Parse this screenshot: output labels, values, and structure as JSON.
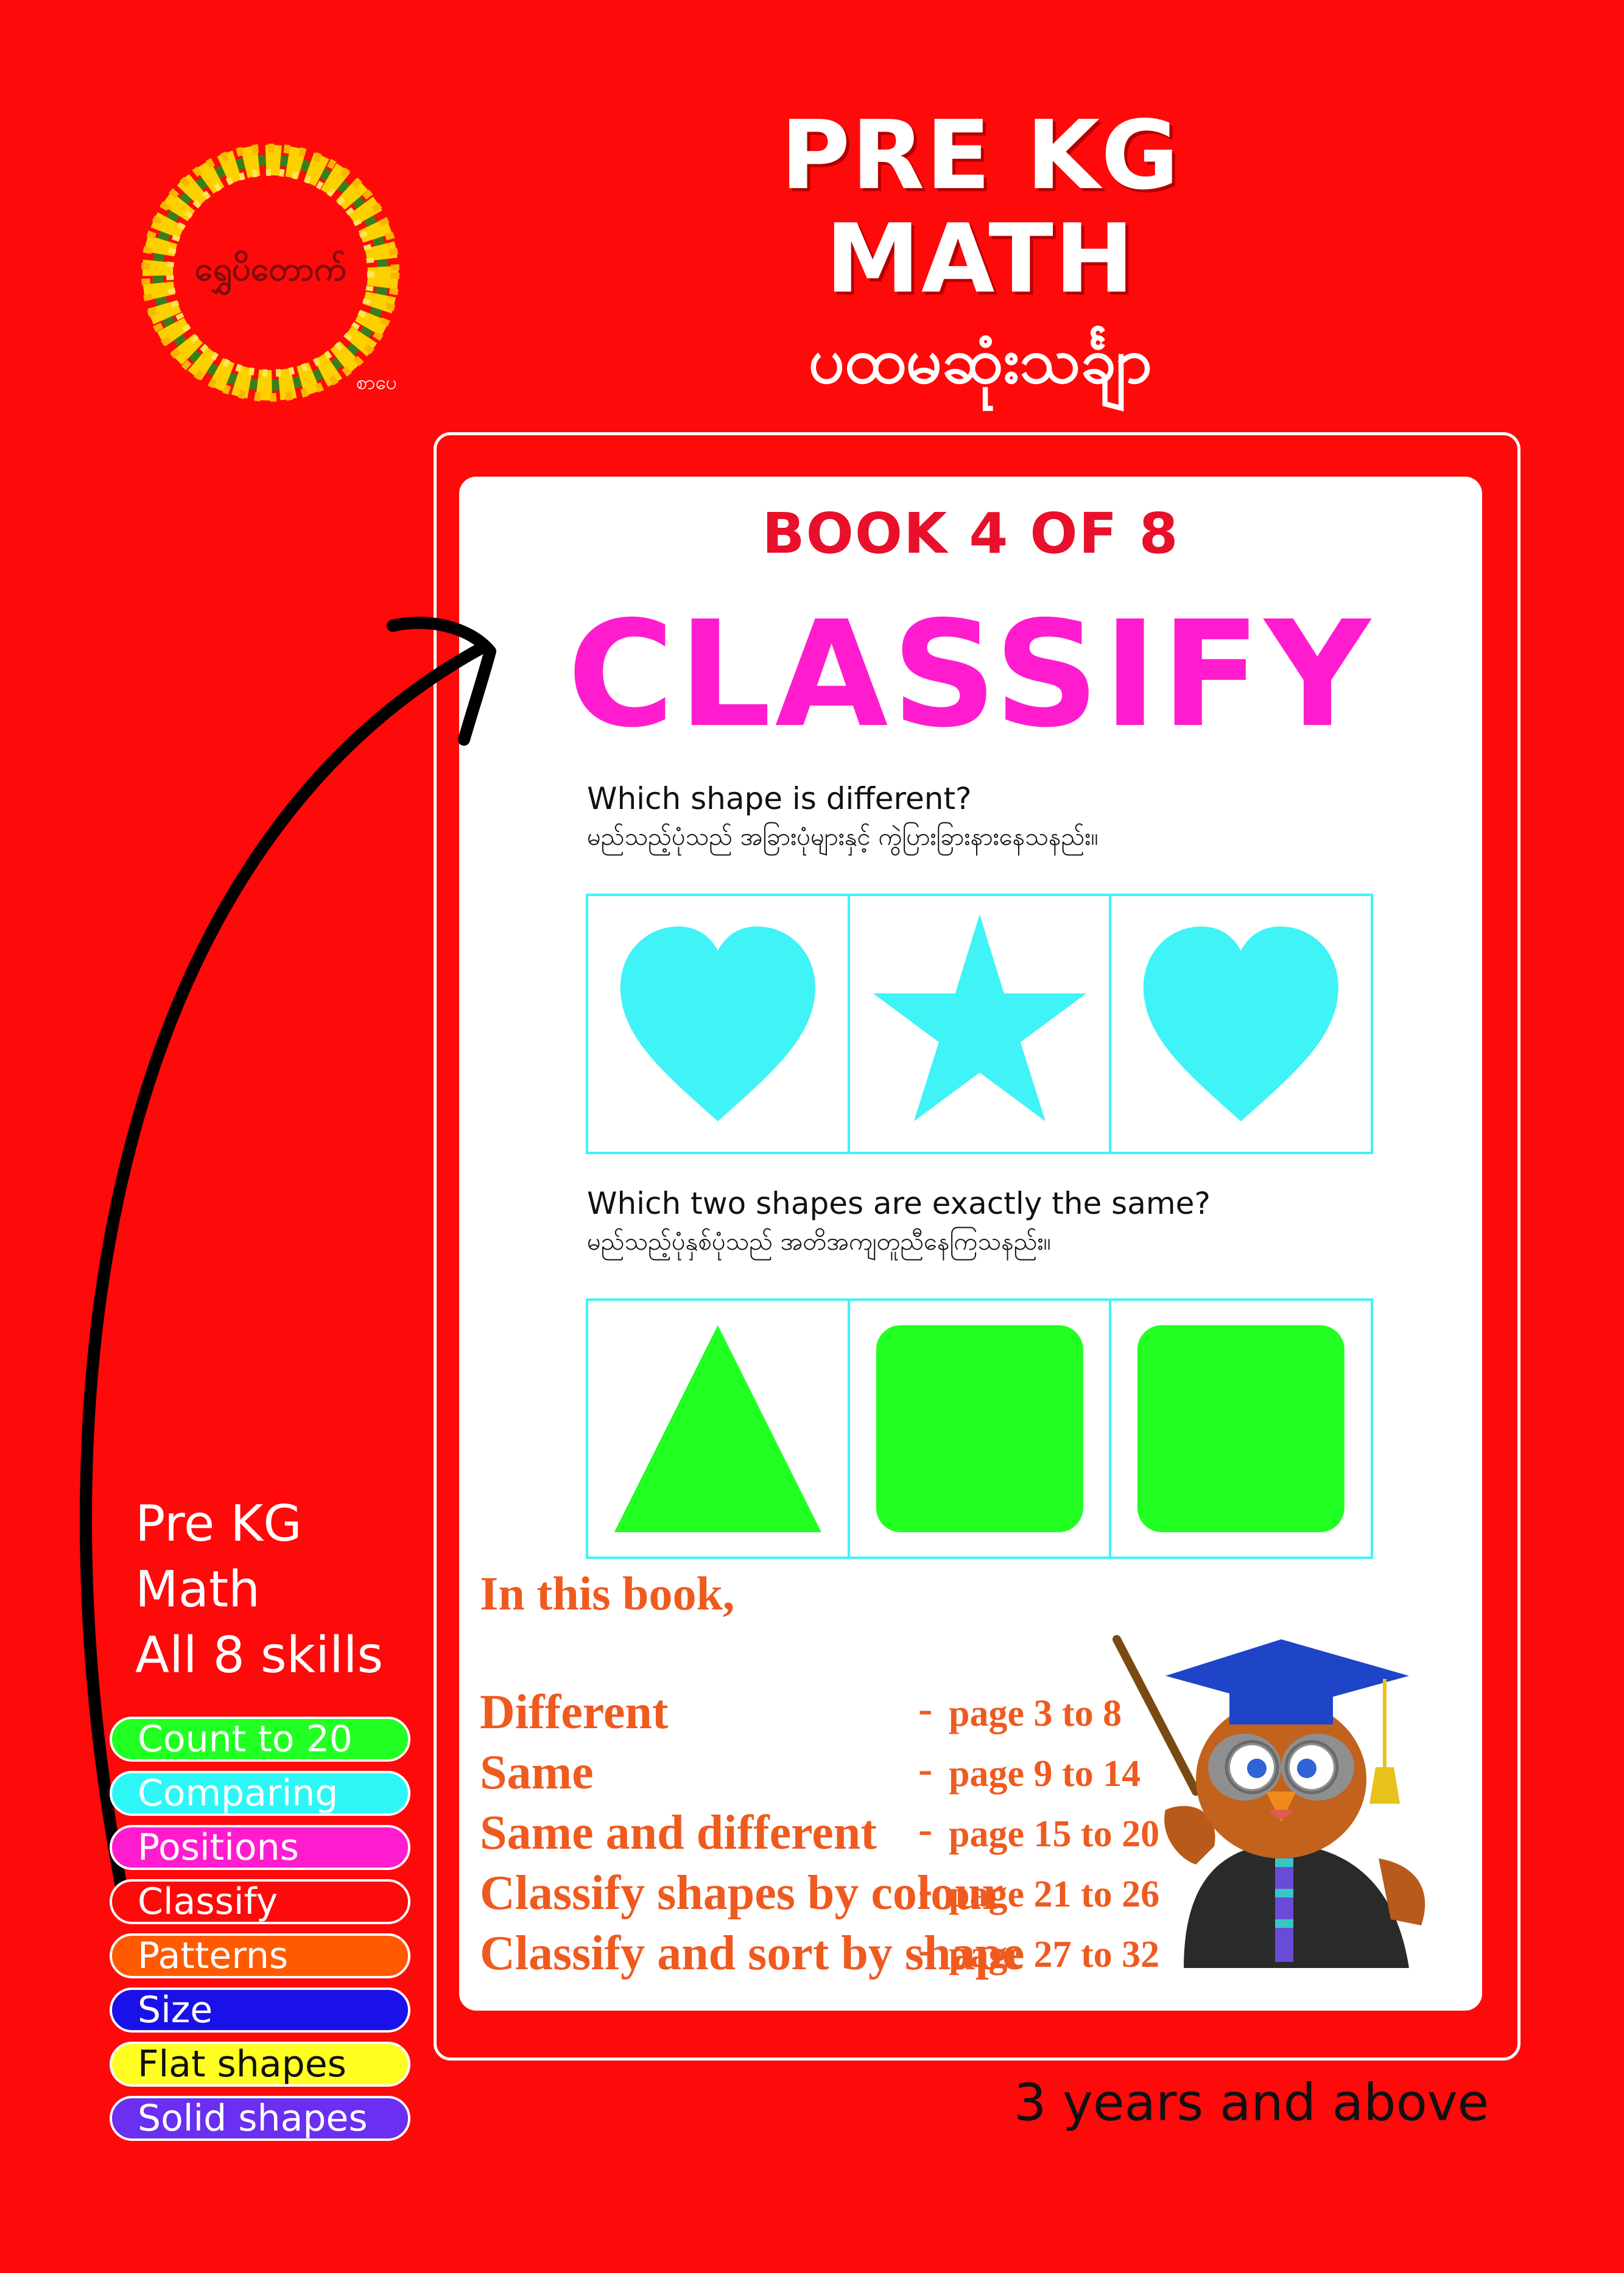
{
  "colors": {
    "background": "#ff0a0a",
    "panel": "#ffffff",
    "book_label": "#e8102a",
    "main_title": "#ff1ccf",
    "cyan": "#3ff3f6",
    "green": "#22ff22",
    "toc_text": "#ef5a1f"
  },
  "logo": {
    "name": "ရွှေပိတောက်",
    "sub": "စာပေ"
  },
  "title": {
    "line1": "PRE KG",
    "line2": "MATH",
    "myanmar": "ပထမဆုံးသင်္ချာ"
  },
  "book": {
    "label": "BOOK 4 OF 8",
    "title": "CLASSIFY"
  },
  "question1": {
    "en": "Which shape is different?",
    "my": "မည်သည့်ပုံသည် အခြားပုံများနှင့် ကွဲပြားခြားနားနေသနည်း။",
    "shapes": [
      "heart",
      "star",
      "heart"
    ]
  },
  "question2": {
    "en": "Which two shapes are exactly the same?",
    "my": "မည်သည့်ပုံနှစ်ပုံသည် အတိအကျတူညီနေကြသနည်း။",
    "shapes": [
      "triangle",
      "rounded-square",
      "rounded-square"
    ]
  },
  "contents": {
    "heading": "In this book,",
    "items": [
      {
        "topic": "Different",
        "dash": "-",
        "pages": "page 3 to 8"
      },
      {
        "topic": "Same",
        "dash": "-",
        "pages": "page 9 to 14"
      },
      {
        "topic": "Same and different",
        "dash": "-",
        "pages": "page 15 to 20"
      },
      {
        "topic": "Classify shapes by colour",
        "dash": "-",
        "pages": "page 21 to 26"
      },
      {
        "topic": "Classify and sort by shape",
        "dash": "-",
        "pages": "page 27 to 32"
      }
    ]
  },
  "skills": {
    "line1": "Pre KG",
    "line2": "Math",
    "line3": "All 8 skills",
    "items": [
      {
        "label": "Count to 20",
        "color": "#22ff22"
      },
      {
        "label": "Comparing",
        "color": "#2ff6f6"
      },
      {
        "label": "Positions",
        "color": "#ff1ccf"
      },
      {
        "label": "Classify",
        "color": "#ff0a0a"
      },
      {
        "label": "Patterns",
        "color": "#ff5a00"
      },
      {
        "label": "Size",
        "color": "#1a10e8"
      },
      {
        "label": "Flat shapes",
        "color": "#ffff22"
      },
      {
        "label": "Solid shapes",
        "color": "#6a2ff0"
      }
    ]
  },
  "age": "3 years and above"
}
